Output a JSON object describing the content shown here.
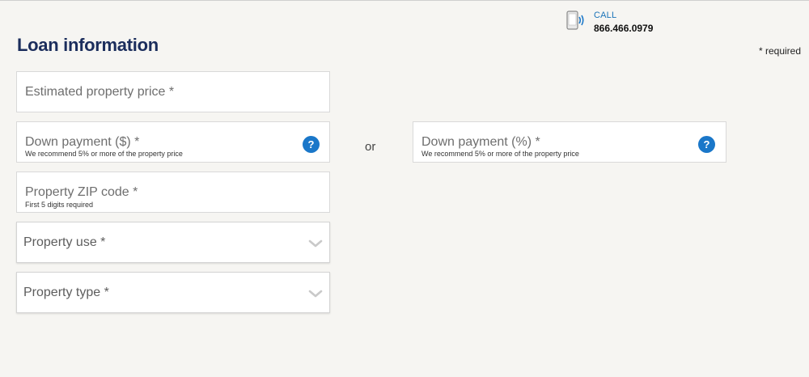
{
  "contact": {
    "call_label": "CALL",
    "phone_number": "866.466.0979",
    "icon": "phone-wireless-icon"
  },
  "page": {
    "title": "Loan information",
    "required_note": "* required",
    "or_text": "or"
  },
  "fields": {
    "property_price": {
      "label": "Estimated property price *"
    },
    "down_payment_dollars": {
      "label": "Down payment ($) *",
      "hint": "We recommend 5% or more of the property price",
      "help_icon": "question-circle-icon"
    },
    "down_payment_percent": {
      "label": "Down payment (%) *",
      "hint": "We recommend 5% or more of the property price",
      "help_icon": "question-circle-icon"
    },
    "zip_code": {
      "label": "Property ZIP code *",
      "hint": "First 5 digits required"
    },
    "property_use": {
      "label": "Property use *",
      "icon": "chevron-down-icon"
    },
    "property_type": {
      "label": "Property type *",
      "icon": "chevron-down-icon"
    }
  },
  "colors": {
    "background": "#f6f5f2",
    "title": "#1b2d5c",
    "accent": "#1a77c9",
    "call_label": "#1a73b8"
  }
}
